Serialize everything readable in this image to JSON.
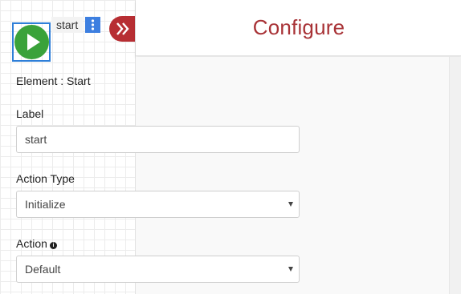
{
  "canvas": {
    "start_node": {
      "label": "start",
      "icon": "play-icon",
      "fill_color": "#3aa23a",
      "selection_color": "#2f7fd8"
    },
    "node_menu_icon": "kebab-menu-icon",
    "collapse_icon": "double-chevron-right-icon"
  },
  "panel": {
    "title": "Configure",
    "title_color": "#a83236",
    "element_caption": "Element : Start",
    "fields": {
      "label": {
        "label": "Label",
        "value": "start"
      },
      "action_type": {
        "label": "Action Type",
        "selected": "Initialize"
      },
      "action": {
        "label": "Action",
        "info_icon": "info-icon",
        "selected": "Default"
      }
    }
  }
}
